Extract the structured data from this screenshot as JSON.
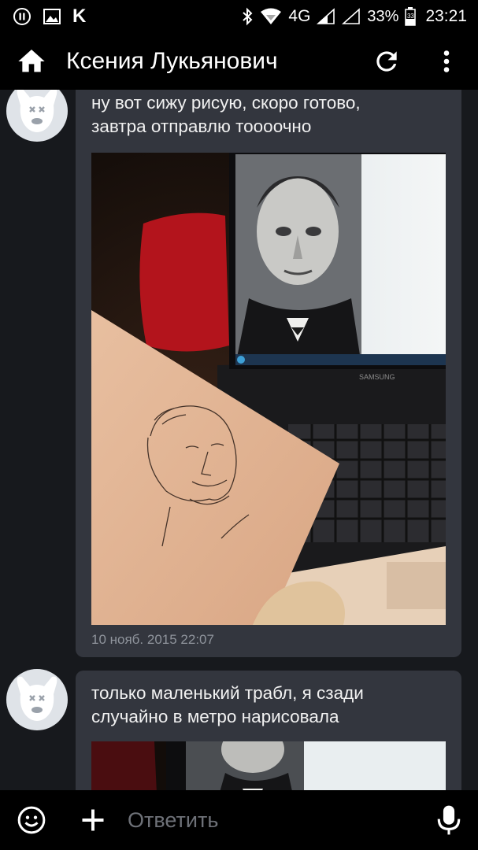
{
  "status_bar": {
    "carrier_letter": "K",
    "network": "4G",
    "battery_percent": "33%",
    "battery_level_text": "33",
    "time": "23:21",
    "icons": [
      "pause-icon",
      "image-icon",
      "bluetooth-icon",
      "wifi-icon",
      "signal-icon",
      "battery-icon"
    ]
  },
  "app_bar": {
    "title": "Ксения Лукьянович",
    "icons": [
      "home-icon",
      "refresh-icon",
      "more-vert-icon"
    ]
  },
  "messages": [
    {
      "text_line1": "ну вот сижу рисую, скоро готово,",
      "text_line2": "завтра отправлю тоооочно",
      "timestamp": "10 нояб. 2015 22:07",
      "laptop_brand": "SAMSUNG"
    },
    {
      "text_line1": "только маленький трабл,  я сзади",
      "text_line2": "случайно в метро нарисовала"
    }
  ],
  "compose": {
    "placeholder": "Ответить",
    "icons": [
      "emoji-icon",
      "add-icon",
      "mic-icon"
    ]
  },
  "colors": {
    "background": "#17191d",
    "bubble": "#33363e",
    "bars": "#000000",
    "timestamp": "#8f949c",
    "placeholder": "#6e7178"
  }
}
